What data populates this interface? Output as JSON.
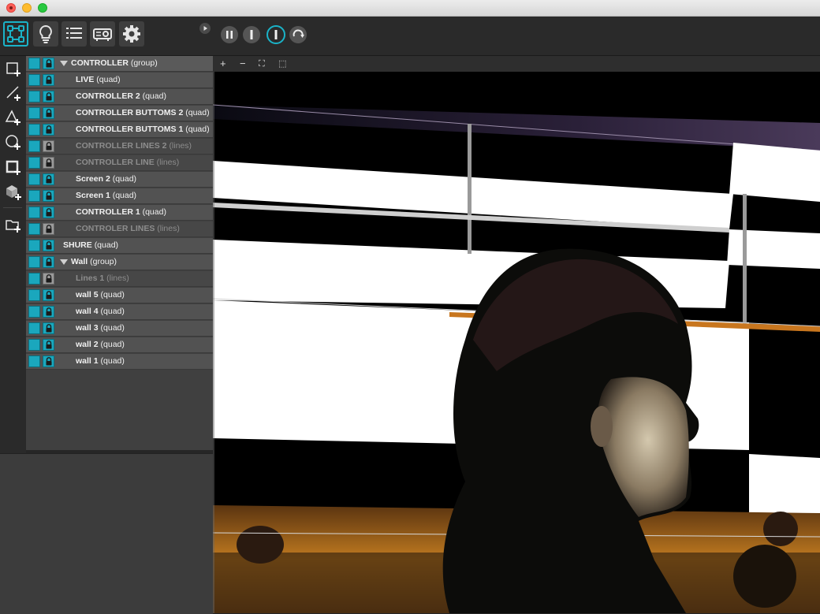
{
  "colors": {
    "accent": "#1aa7bd",
    "panel": "#404040",
    "row": "#525252"
  },
  "window": {
    "controls": [
      "close",
      "minimize",
      "zoom"
    ]
  },
  "toolbar": {
    "buttons": [
      {
        "name": "mapping-icon",
        "active": true
      },
      {
        "name": "lightbulb-icon",
        "active": false
      },
      {
        "name": "list-icon",
        "active": false
      },
      {
        "name": "projector-icon",
        "active": false
      },
      {
        "name": "gear-icon",
        "active": false
      }
    ],
    "transport": [
      "pause-icon",
      "stop-icon",
      "play-icon",
      "loop-icon"
    ]
  },
  "tools": [
    "add-quad-icon",
    "add-line-icon",
    "add-triangle-icon",
    "add-ellipse-icon",
    "add-mesh-icon",
    "add-3d-icon",
    "add-folder-icon"
  ],
  "layers": [
    {
      "name": "CONTROLLER",
      "type": "(group)",
      "indent": 0,
      "group": true,
      "locked": true,
      "dim": false,
      "sel": true
    },
    {
      "name": "LIVE",
      "type": "(quad)",
      "indent": 1,
      "group": false,
      "locked": true,
      "dim": false
    },
    {
      "name": "CONTROLLER 2",
      "type": "(quad)",
      "indent": 1,
      "group": false,
      "locked": true,
      "dim": false
    },
    {
      "name": "CONTROLLER BUTTOMS 2",
      "type": "(quad)",
      "indent": 1,
      "group": false,
      "locked": true,
      "dim": false
    },
    {
      "name": "CONTROLLER BUTTOMS 1",
      "type": "(quad)",
      "indent": 1,
      "group": false,
      "locked": true,
      "dim": false
    },
    {
      "name": "CONTROLLER LINES 2",
      "type": "(lines)",
      "indent": 1,
      "group": false,
      "locked": false,
      "dim": true
    },
    {
      "name": "CONTROLLER LINE",
      "type": "(lines)",
      "indent": 1,
      "group": false,
      "locked": false,
      "dim": true
    },
    {
      "name": "Screen 2",
      "type": "(quad)",
      "indent": 1,
      "group": false,
      "locked": true,
      "dim": false
    },
    {
      "name": "Screen 1",
      "type": "(quad)",
      "indent": 1,
      "group": false,
      "locked": true,
      "dim": false
    },
    {
      "name": "CONTROLLER 1",
      "type": "(quad)",
      "indent": 1,
      "group": false,
      "locked": true,
      "dim": false
    },
    {
      "name": "CONTROLER LINES",
      "type": "(lines)",
      "indent": 1,
      "group": false,
      "locked": false,
      "dim": true
    },
    {
      "name": "SHURE",
      "type": "(quad)",
      "indent": 0,
      "group": false,
      "locked": true,
      "dim": false
    },
    {
      "name": "Wall",
      "type": "(group)",
      "indent": 0,
      "group": true,
      "locked": true,
      "dim": false
    },
    {
      "name": "Lines 1",
      "type": "(lines)",
      "indent": 1,
      "group": false,
      "locked": false,
      "dim": true
    },
    {
      "name": "wall 5",
      "type": "(quad)",
      "indent": 1,
      "group": false,
      "locked": true,
      "dim": false
    },
    {
      "name": "wall 4",
      "type": "(quad)",
      "indent": 1,
      "group": false,
      "locked": true,
      "dim": false
    },
    {
      "name": "wall 3",
      "type": "(quad)",
      "indent": 1,
      "group": false,
      "locked": true,
      "dim": false
    },
    {
      "name": "wall 2",
      "type": "(quad)",
      "indent": 1,
      "group": false,
      "locked": true,
      "dim": false
    },
    {
      "name": "wall 1",
      "type": "(quad)",
      "indent": 1,
      "group": false,
      "locked": true,
      "dim": false
    }
  ],
  "canvas_toolbar": {
    "zoom_in": "+",
    "zoom_out": "−",
    "fit": "⛶",
    "select": "⬚"
  }
}
